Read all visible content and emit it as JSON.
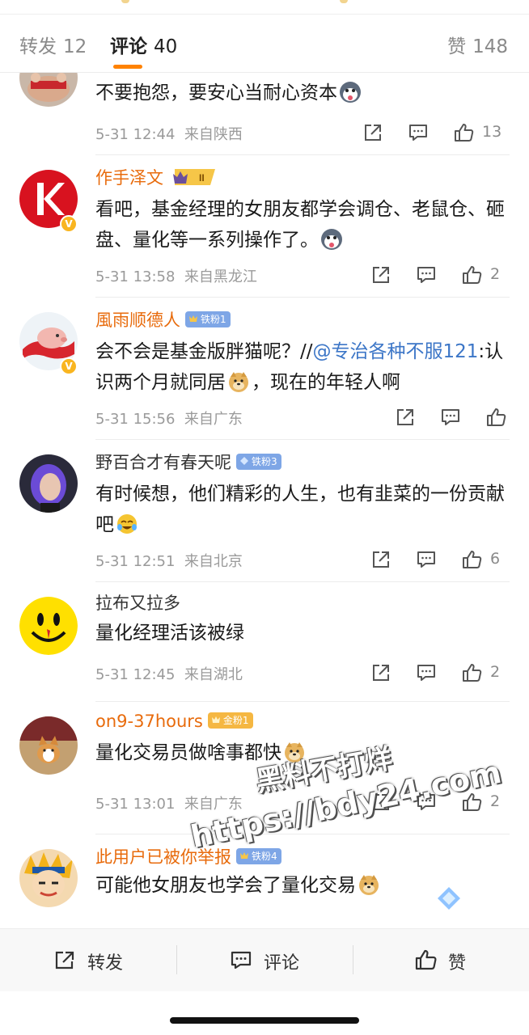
{
  "tabs": {
    "reposts_label": "转发",
    "reposts_count": "12",
    "comments_label": "评论",
    "comments_count": "40",
    "likes_label": "赞",
    "likes_count": "148"
  },
  "comments": [
    {
      "username": "",
      "text": "不要抱怨，要安心当耐心资本",
      "date": "5-31 12:44",
      "location": "来自陕西",
      "likes": "13"
    },
    {
      "username": "作手泽文",
      "badge": "II",
      "text": "看吧，基金经理的女朋友都学会调仓、老鼠仓、砸盘、量化等一系列操作了。",
      "date": "5-31 13:58",
      "location": "来自黑龙江",
      "likes": "2"
    },
    {
      "username": "風雨顺德人",
      "badge": "铁粉1",
      "text_before": "会不会是基金版胖猫呢？//",
      "mention": "@专治各种不服121",
      "text_after": ":认识两个月就同居",
      "text_tail": "，现在的年轻人啊",
      "date": "5-31 15:56",
      "location": "来自广东",
      "likes": ""
    },
    {
      "username": "野百合才有春天呢",
      "badge": "铁粉3",
      "text": "有时候想，他们精彩的人生，也有韭菜的一份贡献吧",
      "date": "5-31 12:51",
      "location": "来自北京",
      "likes": "6"
    },
    {
      "username": "拉布又拉多",
      "text": "量化经理活该被绿",
      "date": "5-31 12:45",
      "location": "来自湖北",
      "likes": "2"
    },
    {
      "username": "on9-37hours",
      "badge": "金粉1",
      "text": "量化交易员做啥事都快",
      "date": "5-31 13:01",
      "location": "来自广东",
      "likes": "2"
    },
    {
      "username": "此用户已被你举报",
      "badge": "铁粉4",
      "text": "可能他女朋友也学会了量化交易"
    }
  ],
  "bottom_bar": {
    "repost": "转发",
    "comment": "评论",
    "like": "赞"
  },
  "watermark": {
    "line1": "黑料不打烊",
    "line2": "https://bdy24.com"
  },
  "colors": {
    "accent": "#ff8200",
    "username_orange": "#e86b0c",
    "mention_blue": "#3c76c7",
    "iron_fan": "#7ea6e6",
    "gold_fan": "#f5b742"
  }
}
